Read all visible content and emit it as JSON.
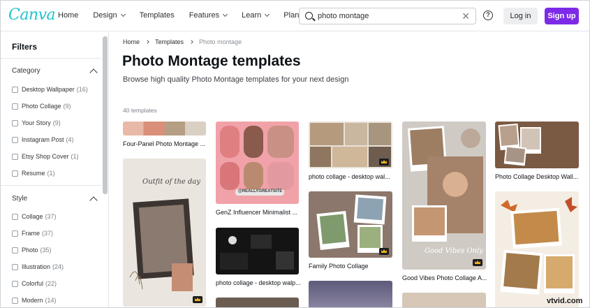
{
  "header": {
    "logo": "Canva",
    "nav": [
      {
        "label": "Home",
        "has_menu": false
      },
      {
        "label": "Design",
        "has_menu": true
      },
      {
        "label": "Templates",
        "has_menu": false
      },
      {
        "label": "Features",
        "has_menu": true
      },
      {
        "label": "Learn",
        "has_menu": true
      },
      {
        "label": "Plans",
        "has_menu": true
      }
    ],
    "search_value": "photo montage",
    "login_label": "Log in",
    "signup_label": "Sign up",
    "accent_color": "#7d2ae8"
  },
  "sidebar": {
    "title": "Filters",
    "category": {
      "title": "Category",
      "items": [
        {
          "label": "Desktop Wallpaper",
          "count": "(16)"
        },
        {
          "label": "Photo Collage",
          "count": "(9)"
        },
        {
          "label": "Your Story",
          "count": "(9)"
        },
        {
          "label": "Instagram Post",
          "count": "(4)"
        },
        {
          "label": "Etsy Shop Cover",
          "count": "(1)"
        },
        {
          "label": "Resume",
          "count": "(1)"
        }
      ]
    },
    "style": {
      "title": "Style",
      "items": [
        {
          "label": "Collage",
          "count": "(37)"
        },
        {
          "label": "Frame",
          "count": "(37)"
        },
        {
          "label": "Photo",
          "count": "(35)"
        },
        {
          "label": "Illustration",
          "count": "(24)"
        },
        {
          "label": "Colorful",
          "count": "(22)"
        },
        {
          "label": "Modern",
          "count": "(14)"
        }
      ]
    }
  },
  "breadcrumb": [
    "Home",
    "Templates",
    "Photo montage"
  ],
  "page_title": "Photo Montage templates",
  "subtitle": "Browse high quality Photo Montage templates for your next design",
  "template_count": "40 templates",
  "cards": [
    {
      "label": "Four-Panel Photo Montage ...",
      "pro": false
    },
    {
      "label": "",
      "pro": true,
      "text_top": "Outfit of the day"
    },
    {
      "label": "GenZ Influencer Minimalist ...",
      "pro": false,
      "handle": "@REALLYGREATSITE"
    },
    {
      "label": "photo collage - desktop walp...",
      "pro": false
    },
    {
      "label": "photo collage - desktop wal...",
      "pro": true
    },
    {
      "label": "Family Photo Collage",
      "pro": true
    },
    {
      "label": "Good Vibes Photo Collage A...",
      "pro": true,
      "script_text": "Good Vibes Only"
    },
    {
      "label": "Photo Collage Desktop Wall...",
      "pro": false
    },
    {
      "label": "",
      "pro": false
    }
  ],
  "watermark": "vtvid.com"
}
